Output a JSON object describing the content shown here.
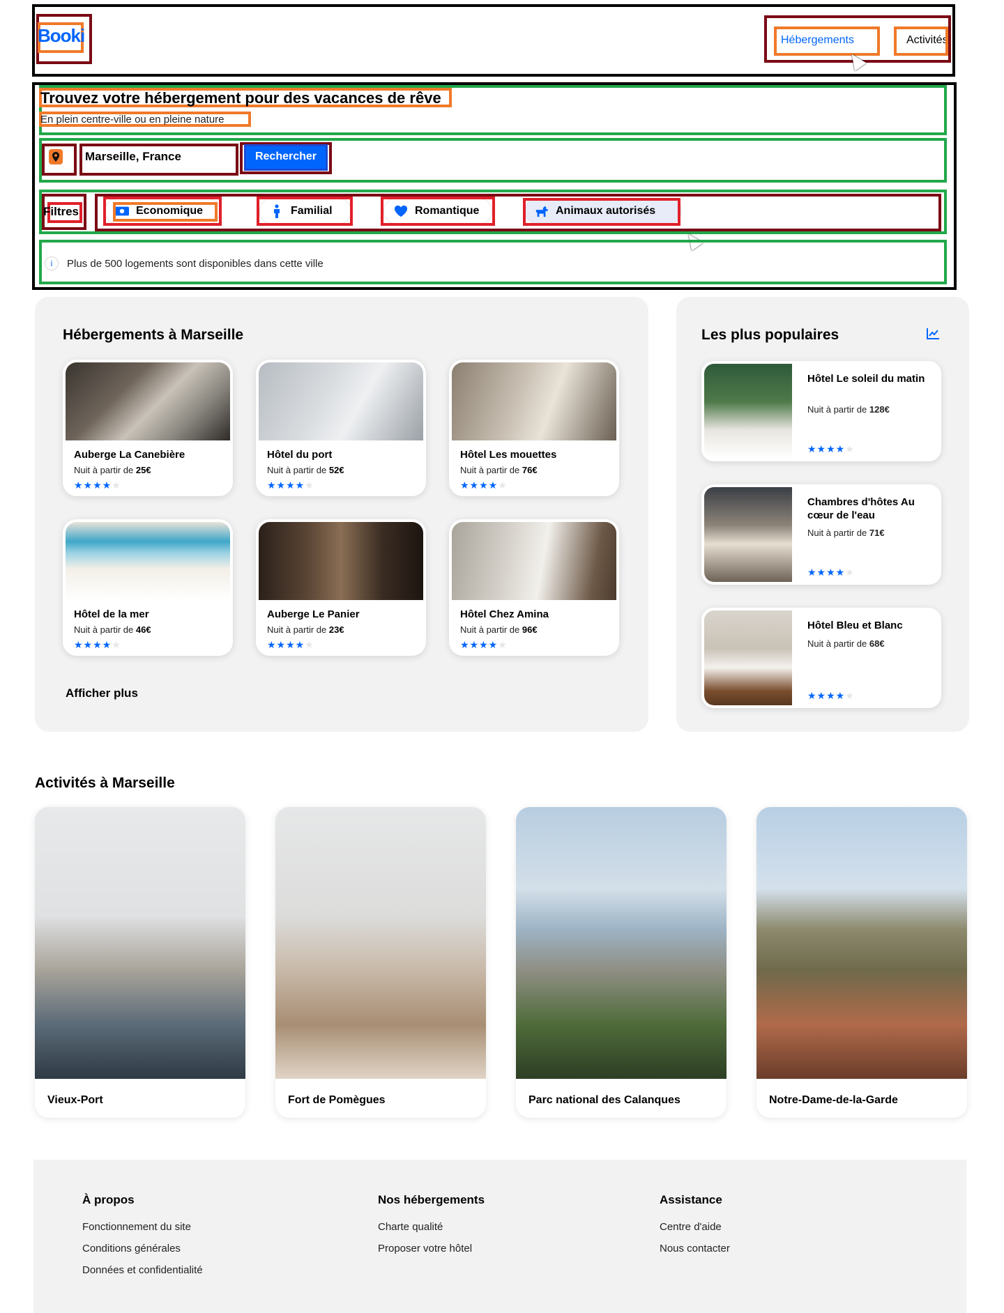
{
  "header": {
    "logo": "Booki",
    "nav": [
      {
        "label": "Hébergements"
      },
      {
        "label": "Activités"
      }
    ]
  },
  "hero": {
    "title": "Trouvez votre hébergement pour des vacances de rêve",
    "subtitle": "En plein centre-ville ou en pleine nature"
  },
  "search": {
    "value": "Marseille, France",
    "button_label": "Rechercher"
  },
  "filters": {
    "label": "Filtres",
    "items": [
      {
        "label": "Economique",
        "icon": "money-icon"
      },
      {
        "label": "Familial",
        "icon": "child-icon"
      },
      {
        "label": "Romantique",
        "icon": "heart-icon"
      },
      {
        "label": "Animaux autorisés",
        "icon": "dog-icon"
      }
    ]
  },
  "info": {
    "text": "Plus de 500 logements sont disponibles dans cette ville"
  },
  "accommodations": {
    "title": "Hébergements à Marseille",
    "price_prefix": "Nuit à partir de",
    "items": [
      {
        "name": "Auberge La Canebière",
        "price": "25€",
        "stars": 4
      },
      {
        "name": "Hôtel du port",
        "price": "52€",
        "stars": 4
      },
      {
        "name": "Hôtel Les mouettes",
        "price": "76€",
        "stars": 4
      },
      {
        "name": "Hôtel de la mer",
        "price": "46€",
        "stars": 4
      },
      {
        "name": "Auberge Le Panier",
        "price": "23€",
        "stars": 4
      },
      {
        "name": "Hôtel Chez Amina",
        "price": "96€",
        "stars": 4
      }
    ],
    "show_more": "Afficher plus"
  },
  "popular": {
    "title": "Les plus populaires",
    "icon": "trend-chart-icon",
    "items": [
      {
        "name": "Hôtel Le soleil du matin",
        "price": "128€",
        "stars": 4
      },
      {
        "name": "Chambres d'hôtes Au cœur de l'eau",
        "price": "71€",
        "stars": 4
      },
      {
        "name": "Hôtel Bleu et Blanc",
        "price": "68€",
        "stars": 4
      }
    ]
  },
  "activities": {
    "title": "Activités à Marseille",
    "items": [
      {
        "name": "Vieux-Port"
      },
      {
        "name": "Fort de Pomègues"
      },
      {
        "name": "Parc national des Calanques"
      },
      {
        "name": "Notre-Dame-de-la-Garde"
      }
    ]
  },
  "footer": {
    "columns": [
      {
        "title": "À propos",
        "links": [
          "Fonctionnement du site",
          "Conditions générales",
          "Données et confidentialité"
        ]
      },
      {
        "title": "Nos hébergements",
        "links": [
          "Charte qualité",
          "Proposer votre hôtel"
        ]
      },
      {
        "title": "Assistance",
        "links": [
          "Centre d'aide",
          "Nous contacter"
        ]
      }
    ]
  },
  "colors": {
    "brand": "#0065FC",
    "panel_bg": "#F2F2F2"
  }
}
